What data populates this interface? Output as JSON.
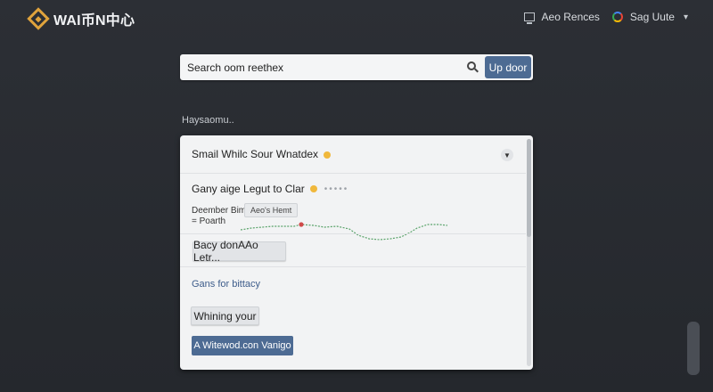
{
  "app": {
    "brand": "WAI币N中心"
  },
  "top_right": {
    "item1_label": "Aeo Rences",
    "account_label": "Sag Uute"
  },
  "search": {
    "value": "Search oom reethex",
    "button_label": "Up door"
  },
  "section_label": "Haysaomu..",
  "panel": {
    "header_text": "Smail Whilc Sour Wnatdex",
    "row2_text": "Gany aige Legut to Clar",
    "legend_line1": "Deember Bimt",
    "legend_line2": "= Poarth",
    "tooltip": "Aeo's Hemt",
    "button1": "Bacy donAAo Letr...",
    "link": "Gans for bittacy",
    "button2": "Whining your",
    "primary_button": "A Witewod.con Vanigo"
  },
  "colors": {
    "accent": "#4d6b93",
    "brand": "#e0a33c",
    "line": "#5aa36a",
    "marker": "#d04a4a"
  }
}
